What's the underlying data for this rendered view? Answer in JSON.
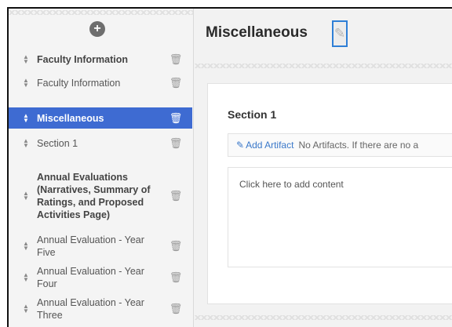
{
  "sidebar": {
    "add_icon": "plus-circle-icon",
    "items": [
      {
        "label": "Faculty Information",
        "bold": true
      },
      {
        "label": "Faculty Information",
        "bold": false
      },
      {
        "label": "Miscellaneous",
        "bold": true,
        "active": true
      },
      {
        "label": "Section 1",
        "bold": false
      },
      {
        "label": "Annual Evaluations (Narratives, Summary of Ratings, and Proposed Activities Page)",
        "bold": true
      },
      {
        "label": "Annual Evaluation - Year Five",
        "bold": false
      },
      {
        "label": "Annual Evaluation - Year Four",
        "bold": false
      },
      {
        "label": "Annual Evaluation - Year Three",
        "bold": false
      }
    ]
  },
  "main": {
    "title": "Miscellaneous",
    "section": {
      "title": "Section 1",
      "add_artifact_label": "Add Artifact",
      "no_artifacts_text": "No Artifacts. If there are no a",
      "content_placeholder": "Click here to add content"
    }
  },
  "colors": {
    "active_bg": "#3e6bd2",
    "link": "#3a78c9",
    "edit_outline": "#2f7fd6"
  }
}
